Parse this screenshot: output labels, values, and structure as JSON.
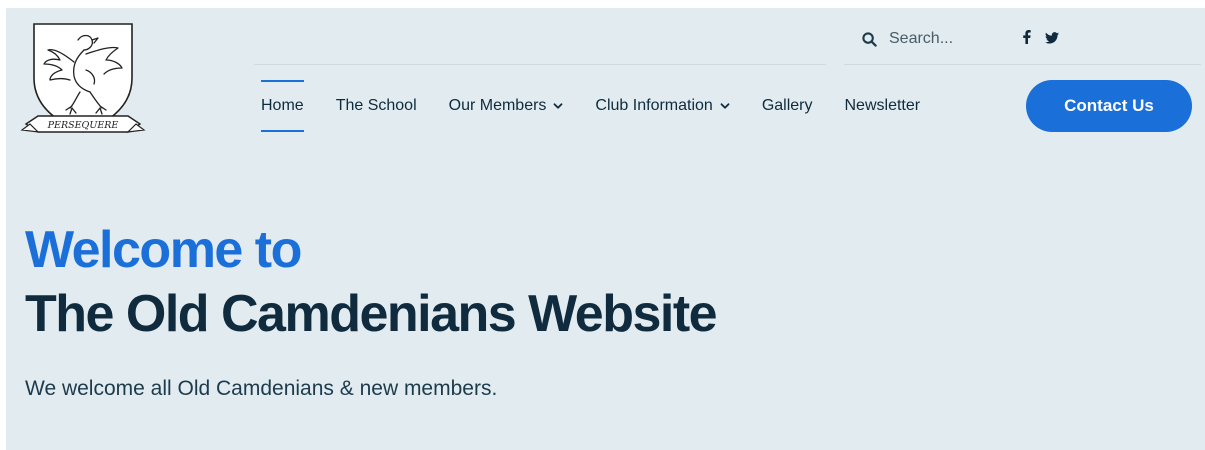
{
  "logo": {
    "motto": "PERSEQUERE",
    "icon": "heraldic-bird-crest"
  },
  "search": {
    "icon": "search-icon",
    "placeholder": "Search..."
  },
  "social": [
    {
      "icon": "facebook-icon",
      "label": "f"
    },
    {
      "icon": "twitter-icon"
    }
  ],
  "nav": {
    "items": [
      {
        "label": "Home",
        "active": true,
        "dropdown": false
      },
      {
        "label": "The School",
        "dropdown": false
      },
      {
        "label": "Our Members",
        "dropdown": true
      },
      {
        "label": "Club Information",
        "dropdown": true
      },
      {
        "label": "Gallery",
        "dropdown": false
      },
      {
        "label": "Newsletter",
        "dropdown": false
      }
    ],
    "cta_label": "Contact Us"
  },
  "hero": {
    "line1": "Welcome to",
    "line2": "The Old Camdenians Website",
    "subtitle": "We welcome all Old Camdenians & new members."
  },
  "colors": {
    "accent": "#1a6fd9",
    "heading": "#0f2b3d",
    "background": "#e1ebf0"
  }
}
